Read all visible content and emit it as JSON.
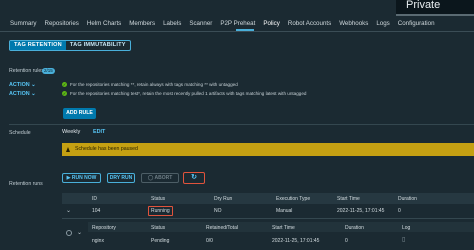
{
  "header": {
    "private_label": "Private"
  },
  "tabs": [
    {
      "label": "Summary"
    },
    {
      "label": "Repositories"
    },
    {
      "label": "Helm Charts"
    },
    {
      "label": "Members"
    },
    {
      "label": "Labels"
    },
    {
      "label": "Scanner"
    },
    {
      "label": "P2P Preheat"
    },
    {
      "label": "Policy"
    },
    {
      "label": "Robot Accounts"
    },
    {
      "label": "Webhooks"
    },
    {
      "label": "Logs"
    },
    {
      "label": "Configuration"
    }
  ],
  "active_tab": "Policy",
  "subtabs": {
    "retention": "TAG RETENTION",
    "immutability": "TAG IMMUTABILITY"
  },
  "retention": {
    "label": "Retention rules",
    "count": "2/15",
    "rules": [
      {
        "action": "ACTION",
        "text": "For the repositories matching **, retain always with tags matching ** with untagged"
      },
      {
        "action": "ACTION",
        "text": "For the repositories matching test*, retain the most recently pulled 1 artifacts with tags matching latest with untagged"
      }
    ],
    "add_rule": "ADD RULE"
  },
  "schedule": {
    "label": "Schedule",
    "value": "Weekly",
    "edit": "EDIT",
    "warning": "Schedule has been paused"
  },
  "runs": {
    "label": "Retention runs",
    "buttons": {
      "run_now": "RUN NOW",
      "dry_run": "DRY RUN",
      "abort": "ABORT"
    },
    "columns": [
      "ID",
      "Status",
      "Dry Run",
      "Execution Type",
      "Start Time",
      "Duration"
    ],
    "row": {
      "id": "104",
      "status": "Running",
      "dry_run": "NO",
      "execution_type": "Manual",
      "start_time": "2022-11-25, 17:01:45",
      "duration": "0"
    },
    "sub_columns": [
      "Repository",
      "Status",
      "Retained/Total",
      "Start Time",
      "Duration",
      "Log"
    ],
    "sub_row": {
      "repository": "nginx",
      "status": "Pending",
      "retained": "0/0",
      "start_time": "2022-11-25, 17:01:45",
      "duration": "0"
    }
  },
  "colors": {
    "accent": "#49afd9",
    "primary_button": "#0079ad",
    "warning": "#c5a012",
    "highlight": "#e0533c"
  }
}
